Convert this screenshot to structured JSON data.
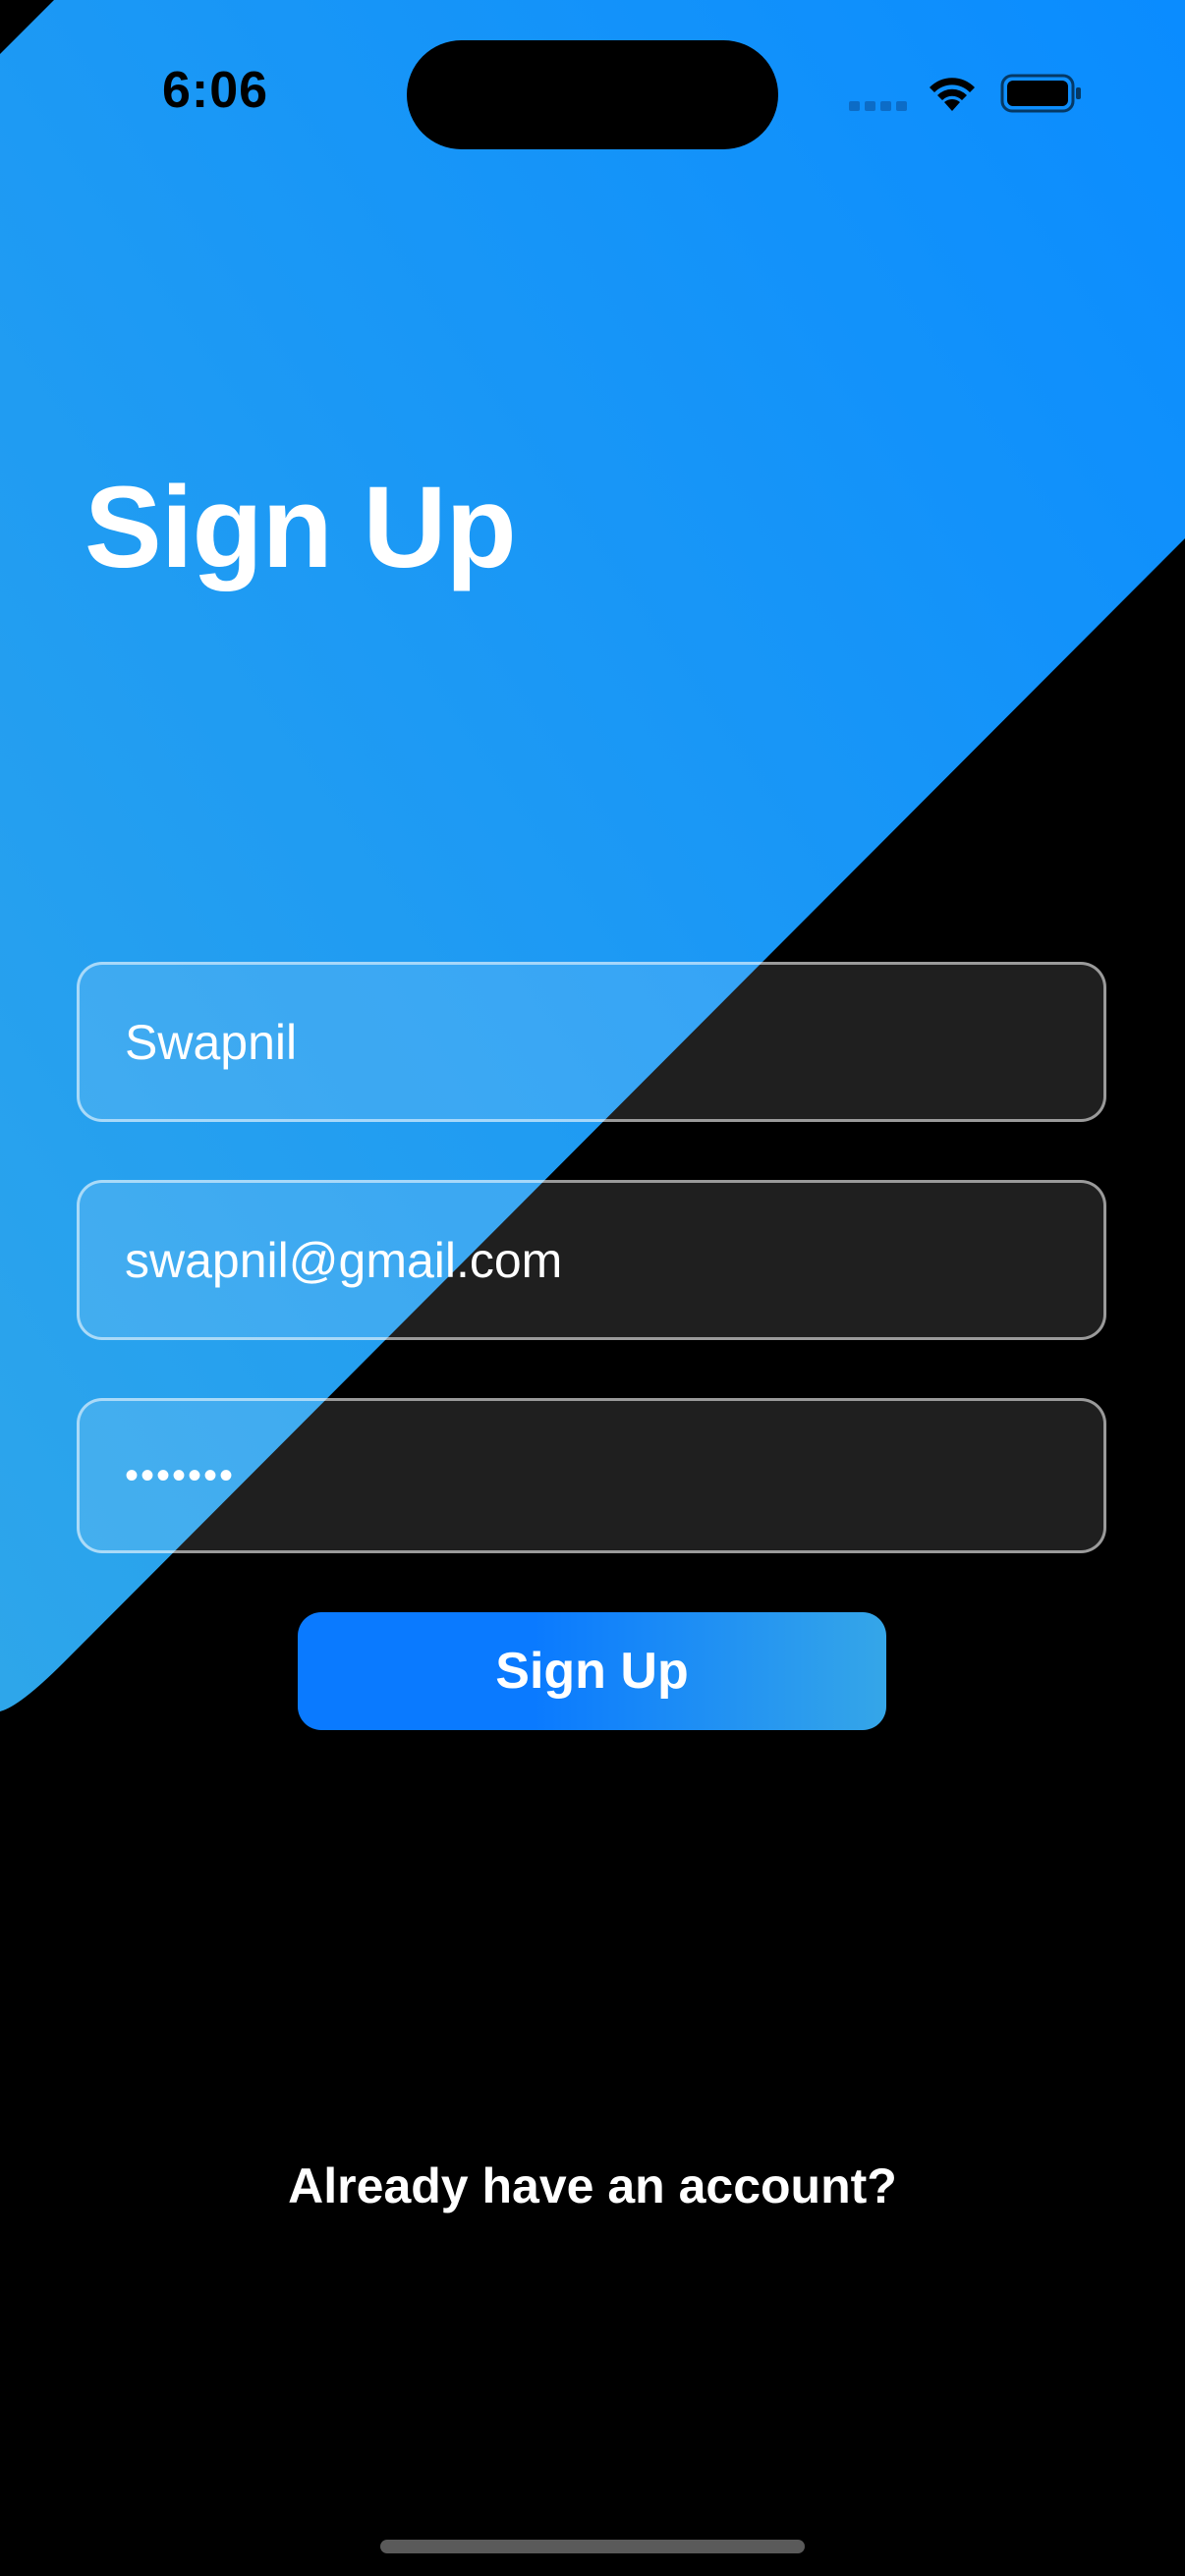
{
  "status_bar": {
    "time": "6:06"
  },
  "title": "Sign Up",
  "form": {
    "name_value": "Swapnil",
    "email_value": "swapnil@gmail.com",
    "password_value": "•••••••"
  },
  "signup_button_label": "Sign Up",
  "login_prompt": "Already have an account?",
  "icons": {
    "signal": "cellular-signal-icon",
    "wifi": "wifi-icon",
    "battery": "battery-icon"
  },
  "colors": {
    "background": "#000000",
    "gradient_top": "#0a8cff",
    "gradient_bottom": "#2ea6ea",
    "button_start": "#0a7aff",
    "button_end": "#35a6e8"
  }
}
